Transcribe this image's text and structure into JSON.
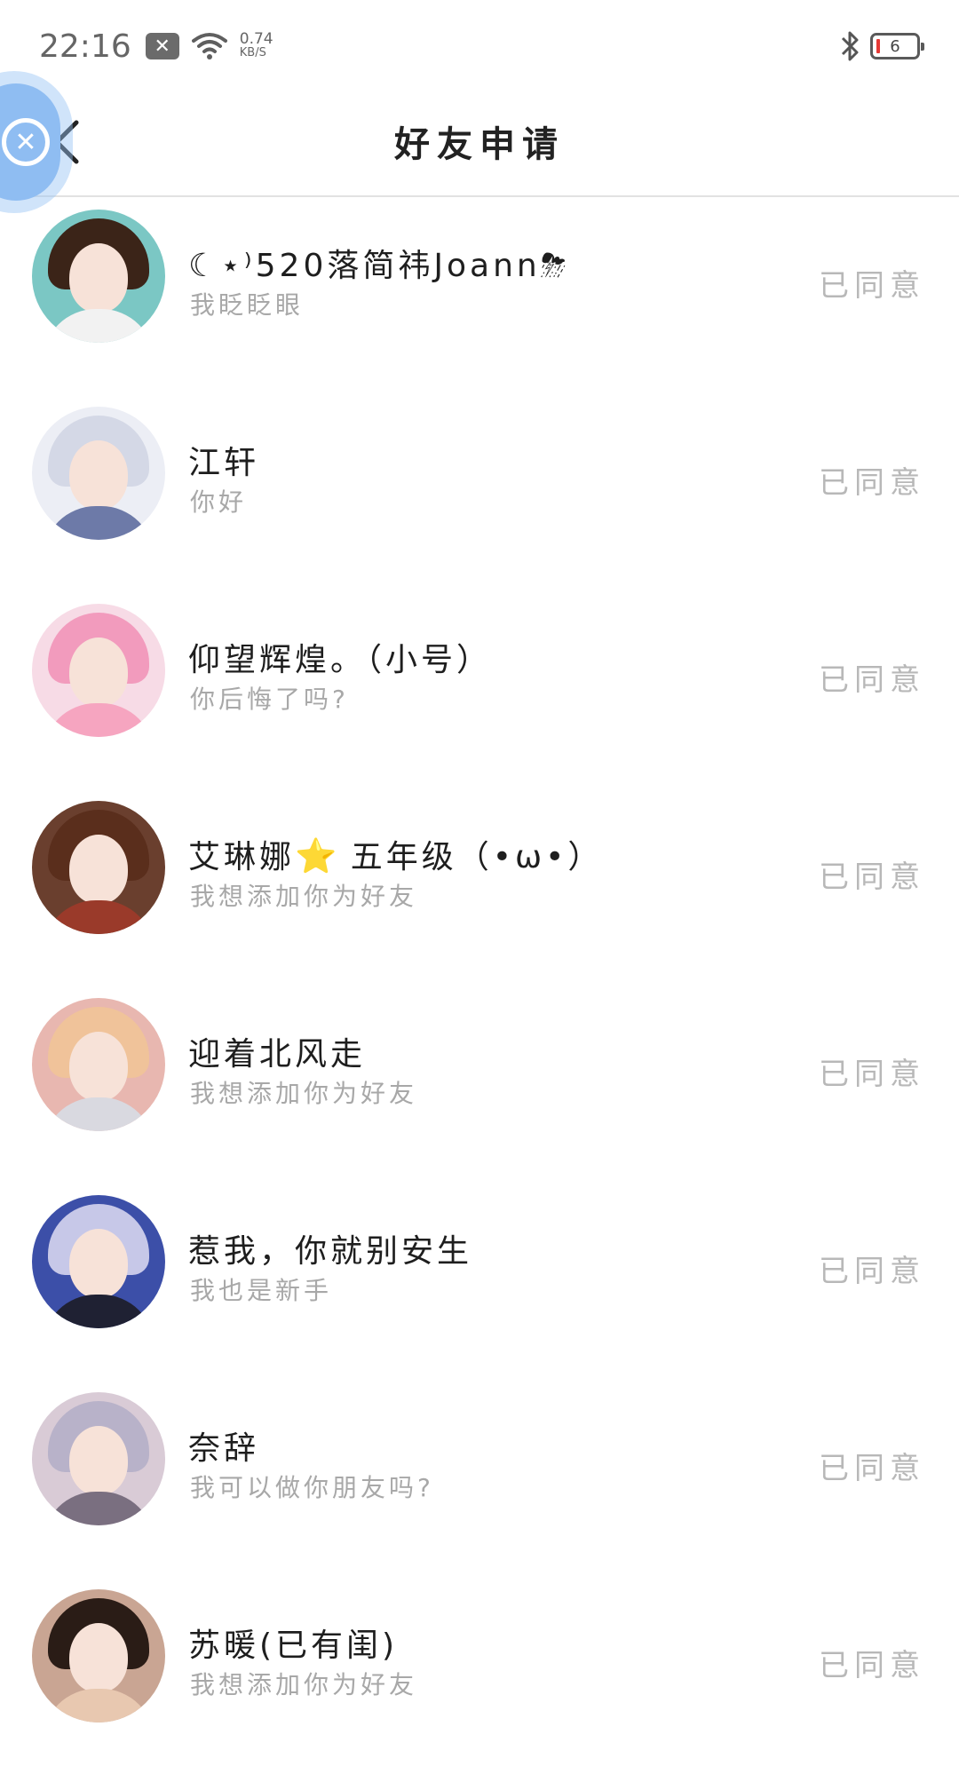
{
  "status_bar": {
    "time": "22:16",
    "net_speed_value": "0.74",
    "net_speed_unit": "KB/S",
    "battery_level": "6"
  },
  "header": {
    "title": "好友申请"
  },
  "requests": [
    {
      "name": "☾⋆⁾520落简祎Joann⛈",
      "message": "我眨眨眼",
      "status": "已同意",
      "avatar_colors": {
        "bg": "#7bc7c4",
        "hair": "#3b2418",
        "body": "#f2f2f2"
      }
    },
    {
      "name": "江轩",
      "message": "你好",
      "status": "已同意",
      "avatar_colors": {
        "bg": "#eceef5",
        "hair": "#d4d8e6",
        "body": "#6d7aa8"
      }
    },
    {
      "name": "仰望辉煌。（小号）",
      "message": "你后悔了吗?",
      "status": "已同意",
      "avatar_colors": {
        "bg": "#f7dbe6",
        "hair": "#f29bbd",
        "body": "#f6a5c0"
      }
    },
    {
      "name_before_icon": "艾琳娜",
      "icon": "⭐",
      "name_after_icon": " 五年级（•ω•）",
      "message": "我想添加你为好友",
      "status": "已同意",
      "avatar_colors": {
        "bg": "#6a3f2e",
        "hair": "#5a2e1c",
        "body": "#9a3a2a"
      }
    },
    {
      "name": "迎着北风走",
      "message": "我想添加你为好友",
      "status": "已同意",
      "avatar_colors": {
        "bg": "#e8b7b0",
        "hair": "#f0c39a",
        "body": "#d9d9e0"
      }
    },
    {
      "name": "惹我，你就别安生",
      "message": "我也是新手",
      "status": "已同意",
      "avatar_colors": {
        "bg": "#3c4fa8",
        "hair": "#c7c8e8",
        "body": "#1f2133"
      }
    },
    {
      "name": "奈辞",
      "message": "我可以做你朋友吗?",
      "status": "已同意",
      "avatar_colors": {
        "bg": "#d9cbd6",
        "hair": "#b8b2c9",
        "body": "#7a6f80"
      }
    },
    {
      "name": "苏暖(已有闺)",
      "message": "我想添加你为好友",
      "status": "已同意",
      "avatar_colors": {
        "bg": "#c9a593",
        "hair": "#2a1c16",
        "body": "#e8c8b0"
      }
    }
  ]
}
